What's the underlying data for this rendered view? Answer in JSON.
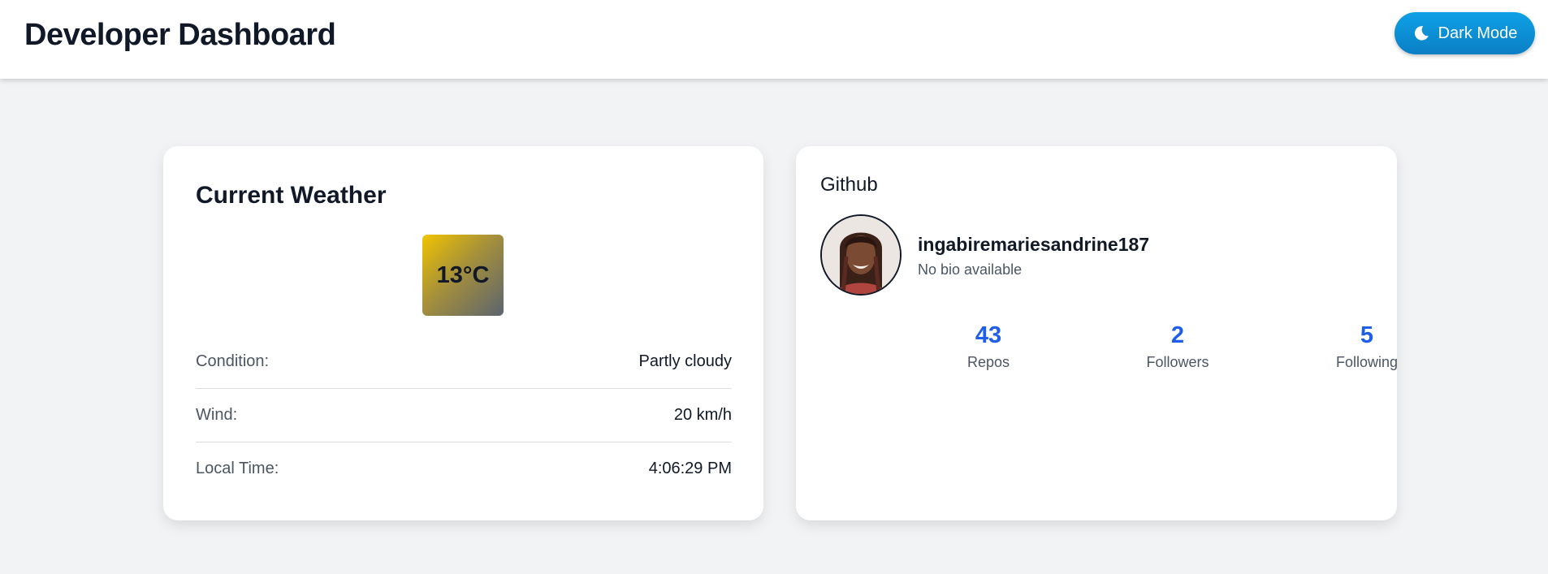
{
  "header": {
    "title": "Developer Dashboard",
    "dark_mode_label": "Dark Mode",
    "dark_mode_icon": "moon-icon"
  },
  "weather": {
    "title": "Current Weather",
    "temperature": "13°C",
    "rows": [
      {
        "label": "Condition:",
        "value": "Partly cloudy"
      },
      {
        "label": "Wind:",
        "value": "20 km/h"
      },
      {
        "label": "Local Time:",
        "value": "4:06:29 PM"
      }
    ]
  },
  "github": {
    "title": "Github",
    "username": "ingabiremariesandrine187",
    "bio": "No bio available",
    "stats": [
      {
        "value": "43",
        "label": "Repos"
      },
      {
        "value": "2",
        "label": "Followers"
      },
      {
        "value": "5",
        "label": "Following"
      }
    ]
  },
  "colors": {
    "accent_blue": "#1f5eea",
    "button_blue": "#0b8fd6",
    "background": "#f2f3f5"
  }
}
